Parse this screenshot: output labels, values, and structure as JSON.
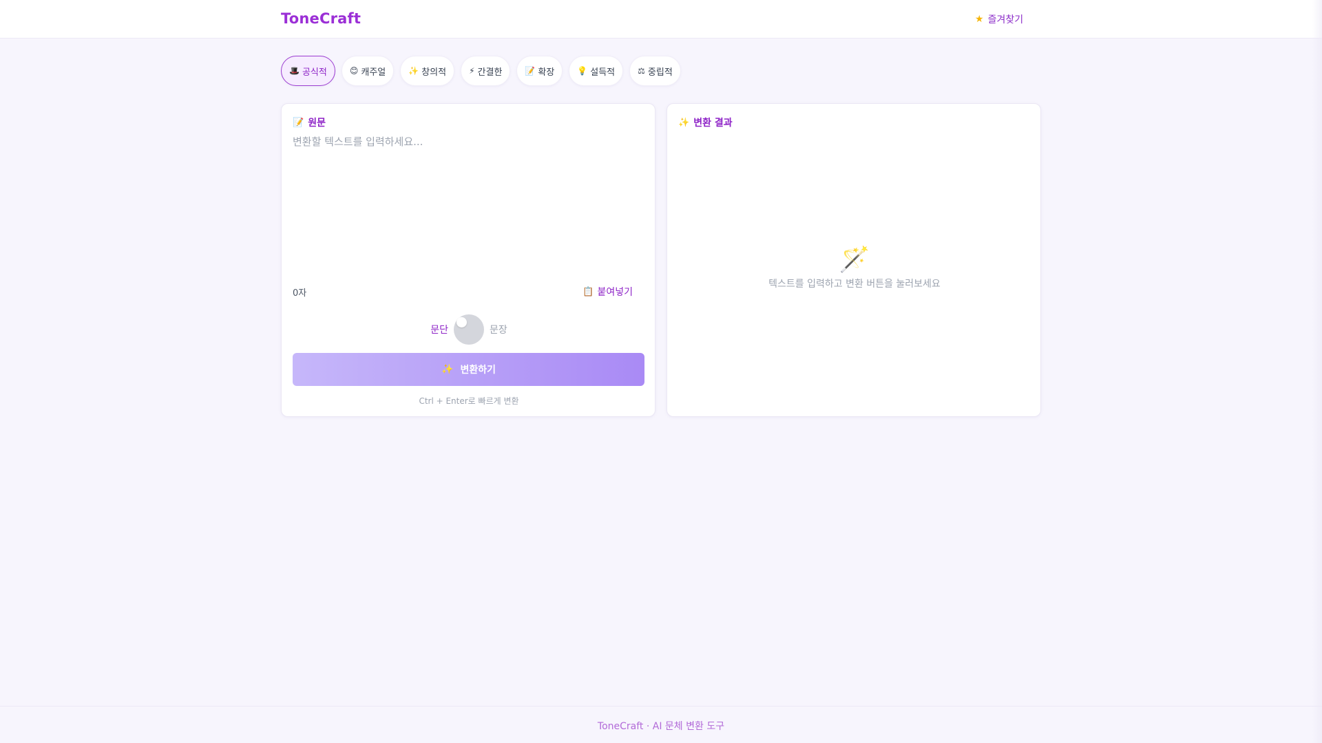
{
  "app": {
    "logo": "ToneCraft",
    "bookmark_icon": "★",
    "bookmark_label": "즐겨찾기"
  },
  "tones": [
    {
      "icon": "🎩",
      "label": "공식적",
      "active": true
    },
    {
      "icon": "😊",
      "label": "캐주얼",
      "active": false
    },
    {
      "icon": "✨",
      "label": "창의적",
      "active": false
    },
    {
      "icon": "⚡",
      "label": "간결한",
      "active": false
    },
    {
      "icon": "📝",
      "label": "확장",
      "active": false
    },
    {
      "icon": "💡",
      "label": "설득적",
      "active": false
    },
    {
      "icon": "⚖",
      "label": "중립적",
      "active": false
    }
  ],
  "input_card": {
    "title_icon": "📝",
    "title": "원문",
    "placeholder": "변환할 텍스트를 입력하세요...",
    "value": "",
    "char_count": "0자",
    "paste_icon": "📋",
    "paste_label": "붙여넣기",
    "mode_left": "문단",
    "mode_right": "문장",
    "convert_icon": "✨",
    "convert_label": "변환하기",
    "shortcut_hint": "Ctrl + Enter로 빠르게 변환"
  },
  "result_card": {
    "title_icon": "✨",
    "title": "변환 결과",
    "empty_icon": "🪄",
    "empty_message": "텍스트를 입력하고 변환 버튼을 눌러보세요"
  },
  "footer": {
    "text": "ToneCraft · AI 문체 변환 도구"
  },
  "colors": {
    "accent": "#8e24c7",
    "background": "#f7f5fd",
    "button_gradient_start": "#c6b7fa",
    "button_gradient_end": "#a98af5"
  }
}
